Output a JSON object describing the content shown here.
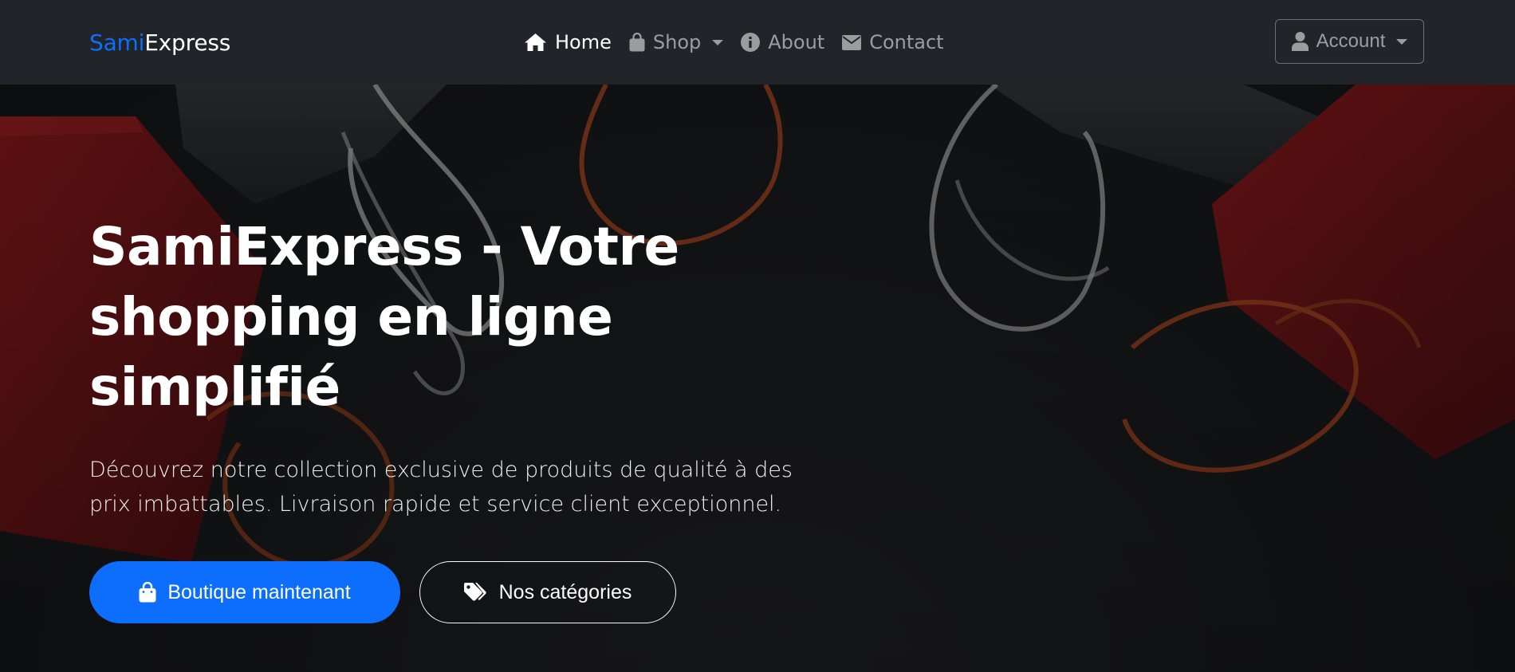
{
  "brand": {
    "part1": "Sami",
    "part2": "Express"
  },
  "nav": {
    "home": "Home",
    "shop": "Shop",
    "about": "About",
    "contact": "Contact"
  },
  "account": {
    "label": "Account"
  },
  "hero": {
    "title": "SamiExpress - Votre shopping en ligne simplifié",
    "subtitle": "Découvrez notre collection exclusive de produits de qualité à des prix imbattables. Livraison rapide et service client exceptionnel.",
    "primary_button": "Boutique maintenant",
    "secondary_button": "Nos catégories"
  },
  "colors": {
    "navbar": "#212529",
    "accent": "#0d6efd",
    "hero_bg": "#141517",
    "bag_red": "#7a1518"
  },
  "icons": {
    "home": "home-icon",
    "shop": "shopping-bag-icon",
    "about": "info-circle-icon",
    "contact": "envelope-icon",
    "account": "user-icon",
    "primary_button": "shopping-bag-icon",
    "secondary_button": "tags-icon"
  }
}
